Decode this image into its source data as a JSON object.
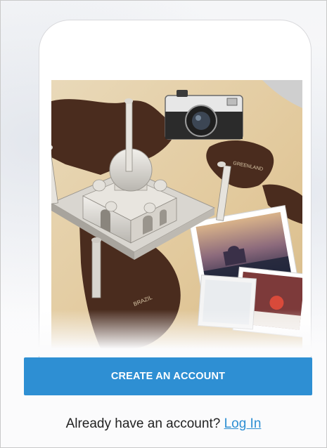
{
  "hero": {
    "map_labels": [
      "GREENLAND",
      "BRAZIL"
    ]
  },
  "signup": {
    "create_account_label": "CREATE AN ACCOUNT"
  },
  "login": {
    "prompt": "Already have an account?",
    "link_label": "Log In"
  },
  "colors": {
    "accent": "#2e8fd3",
    "map_paper": "#e6d2ae",
    "map_land": "#4a2c1e"
  }
}
